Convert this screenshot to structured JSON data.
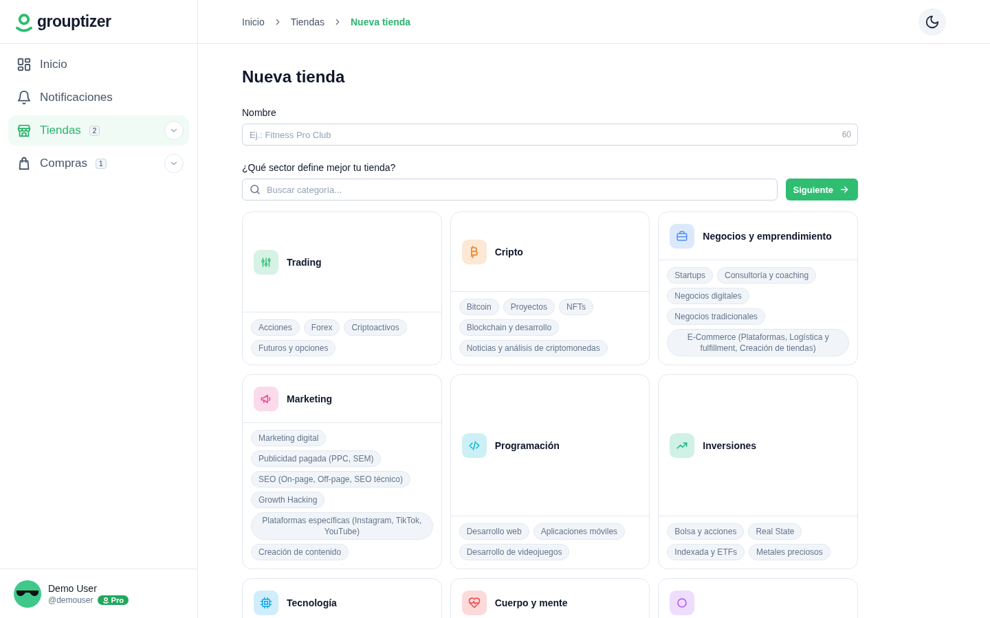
{
  "brand": {
    "name": "grouptizer"
  },
  "sidebar": {
    "items": [
      {
        "label": "Inicio",
        "kind": "link",
        "selected": false
      },
      {
        "label": "Notificaciones",
        "kind": "link",
        "selected": false
      },
      {
        "label": "Tiendas",
        "kind": "group",
        "badge": "2",
        "selected": true,
        "expanded": false
      },
      {
        "label": "Compras",
        "kind": "group",
        "badge": "1",
        "selected": false,
        "expanded": false
      }
    ],
    "user": {
      "name": "Demo User",
      "handle": "@demouser",
      "plan": "Pro"
    }
  },
  "breadcrumbs": [
    {
      "label": "Inicio",
      "selected": false
    },
    {
      "label": "Tiendas",
      "selected": false
    },
    {
      "label": "Nueva tienda",
      "selected": true
    }
  ],
  "page": {
    "title": "Nueva tienda",
    "name_field": {
      "label": "Nombre",
      "placeholder": "Ej.: Fitness Pro Club",
      "counter": "60"
    },
    "sector": {
      "label": "¿Qué sector define mejor tu tienda?",
      "search_placeholder": "Buscar categoría...",
      "next_button": "Siguiente"
    },
    "categories": [
      {
        "title": "Trading",
        "color": "#34c07a",
        "tags": [
          "Acciones",
          "Forex",
          "Criptoactivos",
          "Futuros y opciones"
        ]
      },
      {
        "title": "Cripto",
        "color": "#f28a2e",
        "tags": [
          "Bitcoin",
          "Proyectos",
          "NFTs",
          "Blockchain y desarrollo",
          "Noticias y análisis de criptomonedas"
        ]
      },
      {
        "title": "Negocios y emprendimiento",
        "color": "#4f8ff7",
        "tags": [
          "Startups",
          "Consultoría y coaching",
          "Negocios digitales",
          "Negocios tradicionales",
          "E-Commerce (Plataformas, Logística y fulfillment, Creación de tiendas)"
        ]
      },
      {
        "title": "Marketing",
        "color": "#ec4899",
        "tags": [
          "Marketing digital",
          "Publicidad pagada (PPC, SEM)",
          "SEO (On-page, Off-page, SEO técnico)",
          "Growth Hacking",
          "Plataformas específicas (Instagram, TikTok, YouTube)",
          "Creación de contenido"
        ]
      },
      {
        "title": "Programación",
        "color": "#06b6d4",
        "tags": [
          "Desarrollo web",
          "Aplicaciones móviles",
          "Desarrollo de videojuegos"
        ]
      },
      {
        "title": "Inversiones",
        "color": "#10b981",
        "tags": [
          "Bolsa y acciones",
          "Real State",
          "Indexada y ETFs",
          "Metales preciosos"
        ]
      },
      {
        "title": "Tecnología",
        "color": "#0ea5e9"
      },
      {
        "title": "Cuerpo y mente",
        "color": "#ef4444"
      },
      {
        "color": "#a855f7"
      }
    ]
  }
}
